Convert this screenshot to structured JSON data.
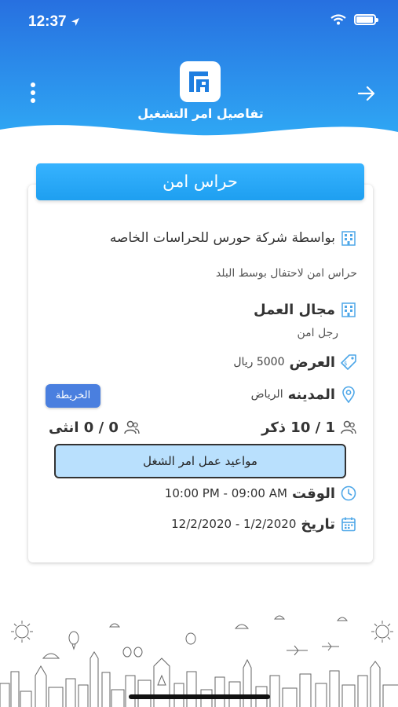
{
  "status_bar": {
    "time": "12:37"
  },
  "header": {
    "title": "تفاصيل امر التشغيل",
    "logo_icon": "company-logo-icon",
    "menu_icon": "more-vertical-icon",
    "back_icon": "arrow-right-icon"
  },
  "colors": {
    "header_blue": "#2a7be4",
    "card_header": "#2ea9fb",
    "map_button": "#4a7fdf",
    "schedule_button": "#b9e0fd",
    "icon_blue": "#4ea7e8"
  },
  "card": {
    "title": "حراس امن",
    "company": "بواسطة شركة حورس للحراسات الخاصه",
    "description": "حراس امن لاحتفال بوسط البلد",
    "field_label": "مجال العمل",
    "field_value": "رجل امن",
    "offer_label": "العرض",
    "offer_value": "5000 ريال",
    "city_label": "المدينه",
    "city_value": "الرياض",
    "map_button": "الخريطة",
    "males": "1 / 10 ذكر",
    "females": "0 / 0 انثى",
    "schedule_button": "مواعيد عمل امر الشغل",
    "time_label": "الوقت",
    "time_value": "10:00 PM - 09:00 AM",
    "date_label": "تاريخ",
    "date_value": "12/2/2020 - 1/2/2020"
  }
}
